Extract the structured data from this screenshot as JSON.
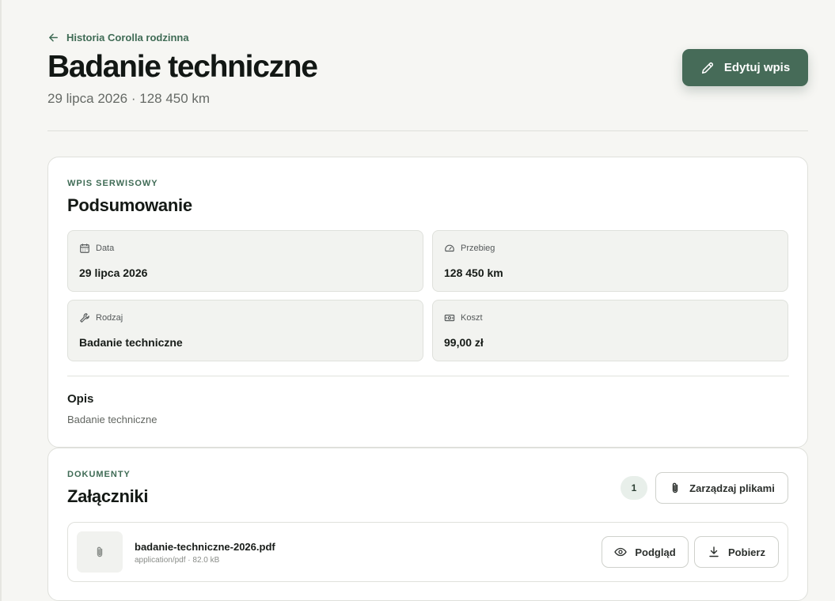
{
  "header": {
    "back_label": "Historia Corolla rodzinna",
    "title": "Badanie techniczne",
    "subtitle": "29 lipca 2026 · 128 450 km",
    "edit_label": "Edytuj wpis"
  },
  "summary": {
    "eyebrow": "WPIS SERWISOWY",
    "title": "Podsumowanie",
    "stats": [
      {
        "label": "Data",
        "value": "29 lipca 2026",
        "icon": "calendar-icon"
      },
      {
        "label": "Przebieg",
        "value": "128 450 km",
        "icon": "gauge-icon"
      },
      {
        "label": "Rodzaj",
        "value": "Badanie techniczne",
        "icon": "wrench-icon"
      },
      {
        "label": "Koszt",
        "value": "99,00 zł",
        "icon": "cash-icon"
      }
    ],
    "description_title": "Opis",
    "description_text": "Badanie techniczne"
  },
  "documents": {
    "eyebrow": "DOKUMENTY",
    "title": "Załączniki",
    "count": "1",
    "manage_label": "Zarządzaj plikami",
    "files": [
      {
        "name": "badanie-techniczne-2026.pdf",
        "meta": "application/pdf · 82.0 kB"
      }
    ],
    "preview_label": "Podgląd",
    "download_label": "Pobierz"
  },
  "colors": {
    "accent": "#466b58",
    "accent_text": "#3f6b55",
    "background": "#f6f6f3"
  }
}
